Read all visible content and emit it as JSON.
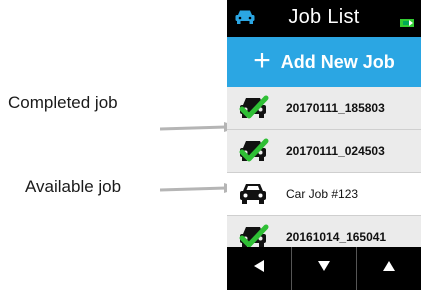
{
  "annotations": {
    "completed_label": "Completed job",
    "available_label": "Available job"
  },
  "header": {
    "title": "Job List",
    "left_icon": "car-icon",
    "right_icon": "battery-icon"
  },
  "add_button": {
    "label": "Add New Job",
    "icon": "plus-icon"
  },
  "jobs": [
    {
      "name": "20170111_185803",
      "status": "completed"
    },
    {
      "name": "20170111_024503",
      "status": "completed"
    },
    {
      "name": "Car Job #123",
      "status": "available"
    },
    {
      "name": "20161014_165041",
      "status": "completed"
    }
  ],
  "navigation": {
    "buttons": [
      "left-arrow-icon",
      "down-arrow-icon",
      "up-arrow-icon"
    ]
  },
  "colors": {
    "accent_blue": "#2ba6e3",
    "check_green": "#2fbf35",
    "battery_green": "#33cc33",
    "row_completed": "#ebebeb",
    "row_available": "#ffffff"
  }
}
